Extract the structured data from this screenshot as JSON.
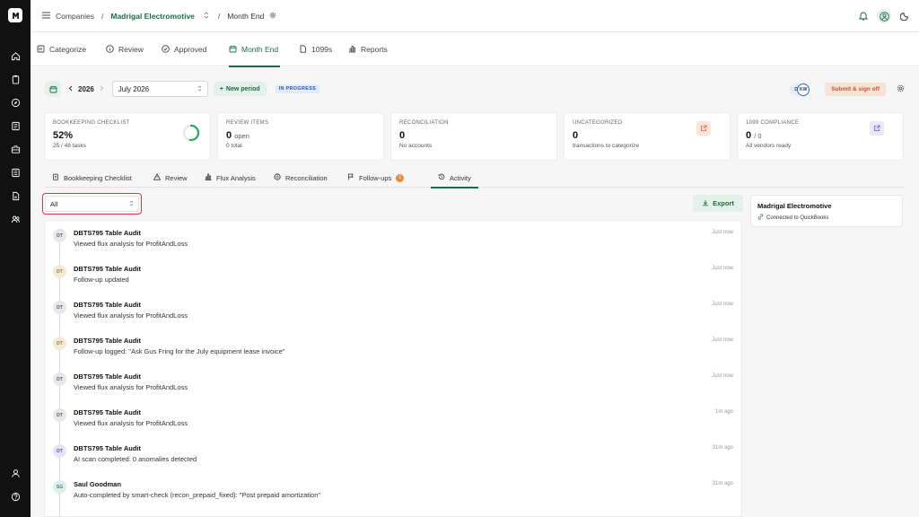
{
  "breadcrumb": {
    "root": "Companies",
    "sep": "/",
    "company": "Madrigal Electromotive",
    "page": "Month End"
  },
  "nav_tabs": [
    {
      "label": "Categorize",
      "icon": "categorize-icon"
    },
    {
      "label": "Review",
      "icon": "info-icon"
    },
    {
      "label": "Approved",
      "icon": "check-circle-icon"
    },
    {
      "label": "Month End",
      "icon": "calendar-icon",
      "active": true
    },
    {
      "label": "1099s",
      "icon": "document-icon"
    },
    {
      "label": "Reports",
      "icon": "bar-chart-icon"
    }
  ],
  "period": {
    "year": "2026",
    "month": "July 2026",
    "new_period_label": "New period",
    "status": "IN PROGRESS",
    "avatars": [
      "D",
      "KW"
    ],
    "submit_label": "Submit & sign off"
  },
  "summary_cards": [
    {
      "label": "BOOKKEEPING CHECKLIST",
      "value": "52%",
      "unit": "",
      "sub": "25 / 48 tasks",
      "progress": 0.52
    },
    {
      "label": "REVIEW ITEMS",
      "value": "0",
      "unit": "open",
      "sub": "0 total"
    },
    {
      "label": "RECONCILIATION",
      "value": "0",
      "unit": "",
      "sub": "No accounts"
    },
    {
      "label": "UNCATEGORIZED",
      "value": "0",
      "unit": "",
      "sub": "transactions to categorize"
    },
    {
      "label": "1099 COMPLIANCE",
      "value": "0",
      "unit": "/ 0",
      "sub": "All vendors ready"
    }
  ],
  "sub_tabs": [
    {
      "label": "Bookkeeping Checklist",
      "icon": "clipboard-icon"
    },
    {
      "label": "Review",
      "icon": "warning-triangle-icon"
    },
    {
      "label": "Flux Analysis",
      "icon": "bar-chart-icon"
    },
    {
      "label": "Reconciliation",
      "icon": "scale-icon"
    },
    {
      "label": "Follow-ups",
      "icon": "flag-icon",
      "count": "1"
    },
    {
      "label": "Activity",
      "icon": "history-icon",
      "active": true
    }
  ],
  "filter": {
    "value": "All"
  },
  "export_label": "Export",
  "activity": [
    {
      "initials": "DT",
      "name": "DBTS795 Table Audit",
      "desc": "Viewed flux analysis for ProfitAndLoss",
      "time": "Just now",
      "color": "#e6e7ea",
      "text": "#555a66"
    },
    {
      "initials": "DT",
      "name": "DBTS795 Table Audit",
      "desc": "Follow-up updated",
      "time": "Just now",
      "color": "#f3ead6",
      "text": "#9a7a3a"
    },
    {
      "initials": "DT",
      "name": "DBTS795 Table Audit",
      "desc": "Viewed flux analysis for ProfitAndLoss",
      "time": "Just now",
      "color": "#e6e7ea",
      "text": "#555a66"
    },
    {
      "initials": "DT",
      "name": "DBTS795 Table Audit",
      "desc": "Follow-up logged: \"Ask Gus Fring for the July equipment lease invoice\"",
      "time": "Just now",
      "color": "#f3ead6",
      "text": "#9a7a3a"
    },
    {
      "initials": "DT",
      "name": "DBTS795 Table Audit",
      "desc": "Viewed flux analysis for ProfitAndLoss",
      "time": "Just now",
      "color": "#e6e7ea",
      "text": "#555a66"
    },
    {
      "initials": "DT",
      "name": "DBTS795 Table Audit",
      "desc": "Viewed flux analysis for ProfitAndLoss",
      "time": "1m ago",
      "color": "#e6e7ea",
      "text": "#555a66"
    },
    {
      "initials": "DT",
      "name": "DBTS795 Table Audit",
      "desc": "AI scan completed: 0 anomalies detected",
      "time": "31m ago",
      "color": "#e6e4f6",
      "text": "#5a4fa8"
    },
    {
      "initials": "SG",
      "name": "Saul Goodman",
      "desc": "Auto-completed by smart-check (recon_prepaid_fixed): \"Post prepaid amortization\"",
      "time": "31m ago",
      "color": "#dcefee",
      "text": "#3c7f7a"
    }
  ],
  "company_card": {
    "name": "Madrigal Electromotive",
    "status": "Connected to QuickBooks"
  },
  "colors": {
    "accent": "#1b6b4a",
    "accent_bg": "#e4f1ea",
    "rail": "#111111",
    "signoff": "#c5562a",
    "focus_ring": "#d9373f"
  }
}
